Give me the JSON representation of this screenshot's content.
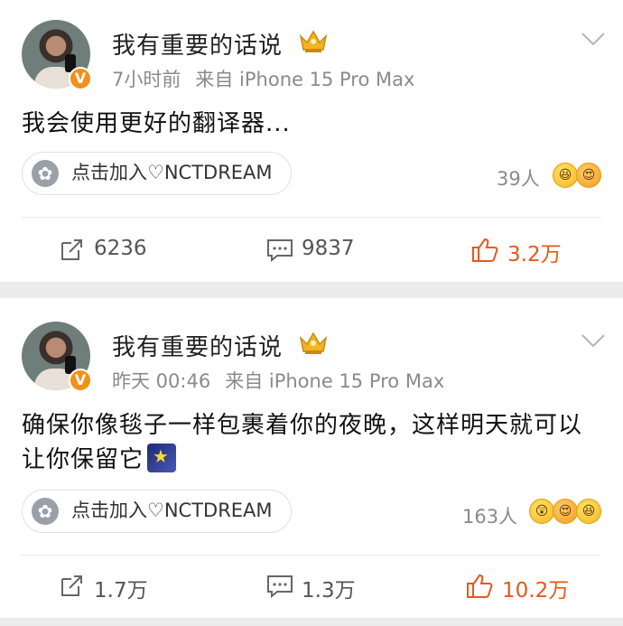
{
  "posts": [
    {
      "username": "我有重要的话说",
      "time": "7小时前",
      "source": "来自 iPhone 15 Pro Max",
      "content": "我会使用更好的翻译器...",
      "has_emoji_in_content": false,
      "tag": "点击加入♡NCTDREAM",
      "likers": "39人",
      "reactions": [
        "laughing-emoji",
        "heart-face-emoji"
      ],
      "reposts": "6236",
      "comments": "9837",
      "likes": "3.2万"
    },
    {
      "username": "我有重要的话说",
      "time": "昨天 00:46",
      "source": "来自 iPhone 15 Pro Max",
      "content": "确保你像毯子一样包裹着你的夜晚，这样明天就可以让你保留它",
      "has_emoji_in_content": true,
      "content_emoji": "shooting-star-emoji",
      "tag": "点击加入♡NCTDREAM",
      "likers": "163人",
      "reactions": [
        "surprised-emoji",
        "heart-face-emoji",
        "laughing-emoji"
      ],
      "reposts": "1.7万",
      "comments": "1.3万",
      "likes": "10.2万"
    }
  ],
  "colors": {
    "accent_like": "#e8571a",
    "verified_badge": "#f3901a",
    "meta_text": "#8a8a8a",
    "background": "#ececec"
  },
  "icons": {
    "verified": "V",
    "crown": "crown-icon",
    "tag": "flower-icon"
  }
}
